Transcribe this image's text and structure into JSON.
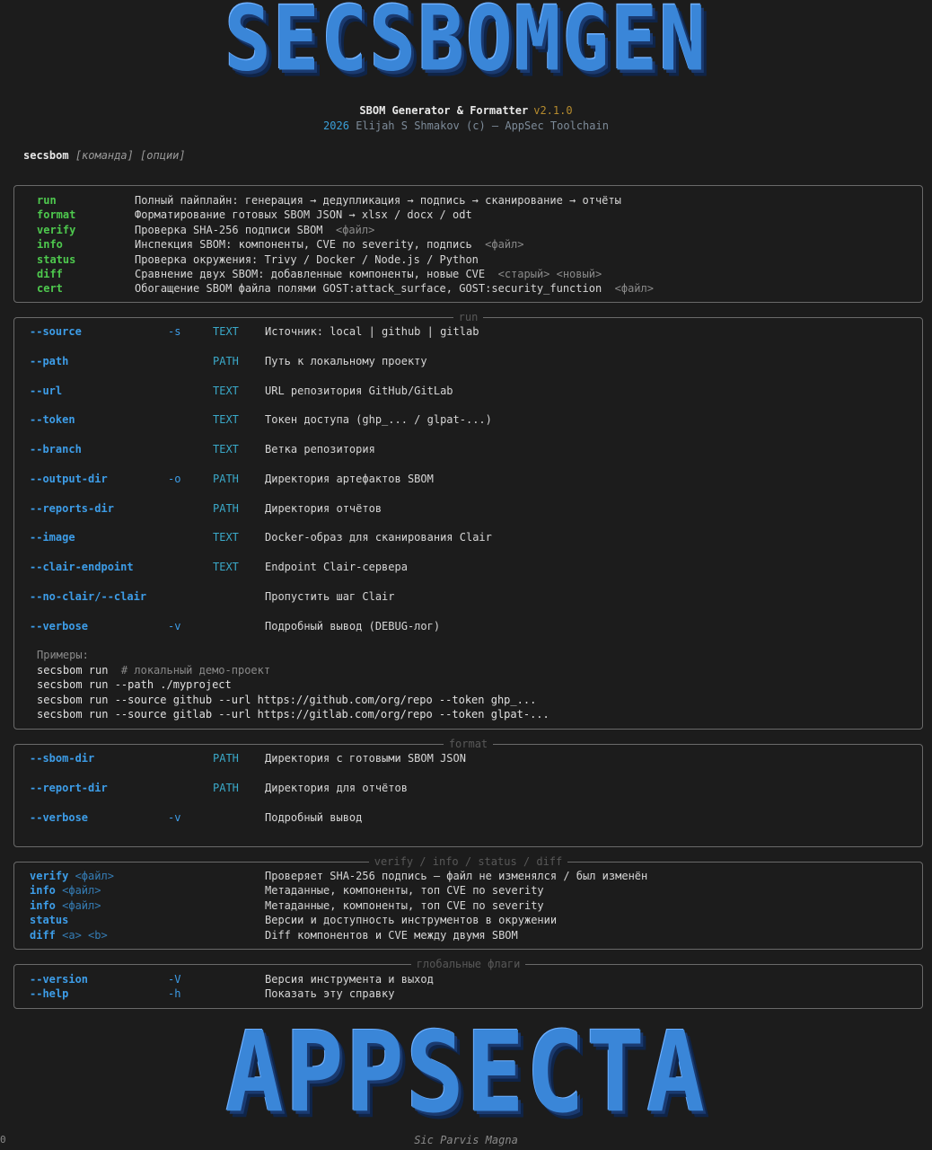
{
  "banner_top": "SECSBOMGEN",
  "banner_bottom": "APPSECTA",
  "subtitle": {
    "name": "SBOM Generator & Formatter",
    "version": "v2.1.0",
    "year": "2026",
    "author": "Elijah S Shmakov (c) — AppSec Toolchain"
  },
  "usage": {
    "prog": "secsbom",
    "args": "[команда] [опции]"
  },
  "commands": [
    {
      "name": "run",
      "desc": "Полный пайплайн: генерация → дедупликация → подпись → сканирование → отчёты",
      "arg": ""
    },
    {
      "name": "format",
      "desc": "Форматирование готовых SBOM JSON → xlsx / docx / odt",
      "arg": ""
    },
    {
      "name": "verify",
      "desc": "Проверка SHA-256 подписи SBOM",
      "arg": "<файл>"
    },
    {
      "name": "info",
      "desc": "Инспекция SBOM: компоненты, CVE по severity, подпись",
      "arg": "<файл>"
    },
    {
      "name": "status",
      "desc": "Проверка окружения: Trivy / Docker / Node.js / Python",
      "arg": ""
    },
    {
      "name": "diff",
      "desc": "Сравнение двух SBOM: добавленные компоненты, новые CVE",
      "arg": "<старый> <новый>"
    },
    {
      "name": "cert",
      "desc": "Обогащение SBOM файла полями GOST:attack_surface, GOST:security_function",
      "arg": "<файл>"
    }
  ],
  "run_panel": {
    "title": "run",
    "options": [
      {
        "flag": "--source",
        "short": "-s",
        "type": "TEXT",
        "desc": "Источник: local | github | gitlab"
      },
      {
        "flag": "--path",
        "short": "",
        "type": "PATH",
        "desc": "Путь к локальному проекту"
      },
      {
        "flag": "--url",
        "short": "",
        "type": "TEXT",
        "desc": "URL репозитория GitHub/GitLab"
      },
      {
        "flag": "--token",
        "short": "",
        "type": "TEXT",
        "desc": "Токен доступа (ghp_... / glpat-...)"
      },
      {
        "flag": "--branch",
        "short": "",
        "type": "TEXT",
        "desc": "Ветка репозитория"
      },
      {
        "flag": "--output-dir",
        "short": "-o",
        "type": "PATH",
        "desc": "Директория артефактов SBOM"
      },
      {
        "flag": "--reports-dir",
        "short": "",
        "type": "PATH",
        "desc": "Директория отчётов"
      },
      {
        "flag": "--image",
        "short": "",
        "type": "TEXT",
        "desc": "Docker-образ для сканирования Clair"
      },
      {
        "flag": "--clair-endpoint",
        "short": "",
        "type": "TEXT",
        "desc": "Endpoint Clair-сервера"
      },
      {
        "flag": "--no-clair/--clair",
        "short": "",
        "type": "",
        "desc": "Пропустить шаг Clair"
      },
      {
        "flag": "--verbose",
        "short": "-v",
        "type": "",
        "desc": "Подробный вывод (DEBUG-лог)"
      }
    ],
    "examples_label": "Примеры:",
    "examples": [
      {
        "cmd": "secsbom run",
        "comment": "# локальный демо-проект"
      },
      {
        "cmd": "secsbom run --path ./myproject",
        "comment": ""
      },
      {
        "cmd": "secsbom run --source github --url https://github.com/org/repo --token ghp_...",
        "comment": ""
      },
      {
        "cmd": "secsbom run --source gitlab --url https://gitlab.com/org/repo --token glpat-...",
        "comment": ""
      }
    ]
  },
  "format_panel": {
    "title": "format",
    "options": [
      {
        "flag": "--sbom-dir",
        "short": "",
        "type": "PATH",
        "desc": "Директория с готовыми SBOM JSON"
      },
      {
        "flag": "--report-dir",
        "short": "",
        "type": "PATH",
        "desc": "Директория для отчётов"
      },
      {
        "flag": "--verbose",
        "short": "-v",
        "type": "",
        "desc": "Подробный вывод"
      }
    ]
  },
  "misc_panel": {
    "title": "verify / info / status / diff",
    "rows": [
      {
        "cmd": "verify",
        "arg": "<файл>",
        "desc": "Проверяет SHA-256 подпись — файл не изменялся / был изменён"
      },
      {
        "cmd": "info",
        "arg": "<файл>",
        "desc": "Метаданные, компоненты, топ CVE по severity"
      },
      {
        "cmd": "info",
        "arg": "<файл>",
        "desc": "Метаданные, компоненты, топ CVE по severity"
      },
      {
        "cmd": "status",
        "arg": "",
        "desc": "Версии и доступность инструментов в окружении"
      },
      {
        "cmd": "diff",
        "arg": "<a> <b>",
        "desc": "Diff компонентов и CVE между двумя SBOM"
      }
    ]
  },
  "global_panel": {
    "title": "глобальные флаги",
    "rows": [
      {
        "flag": "--version",
        "short": "-V",
        "desc": "Версия инструмента и выход"
      },
      {
        "flag": "--help",
        "short": "-h",
        "desc": "Показать эту справку"
      }
    ]
  },
  "footer": "Sic Parvis Magna",
  "corner": "0",
  "colors": {
    "accent": "#3a86d8",
    "command": "#4ec94e",
    "flag": "#3d9de8",
    "type": "#3aa9c9",
    "background": "#1c1c1c",
    "border": "#6a6a6a"
  }
}
